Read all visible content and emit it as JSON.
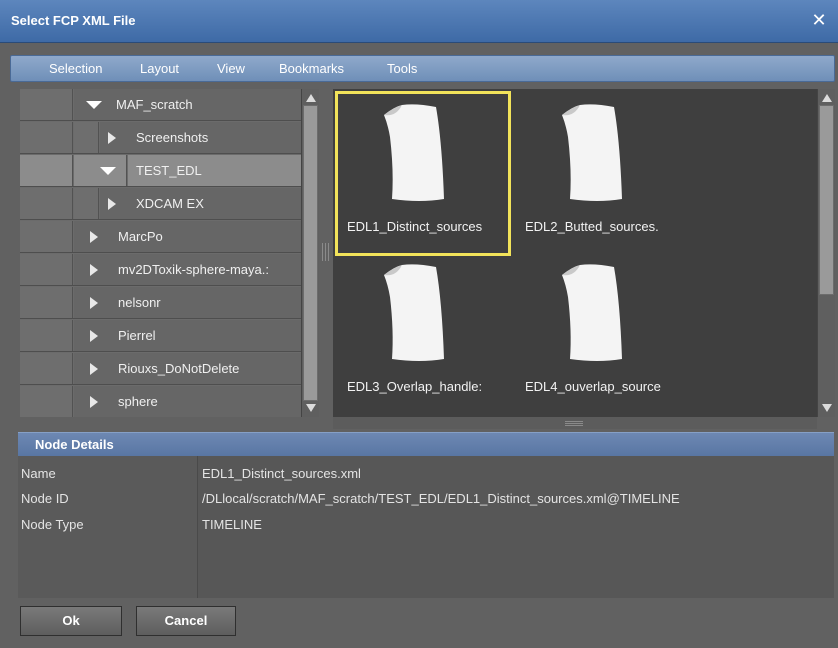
{
  "window": {
    "title": "Select FCP XML File",
    "close_glyph": "✕"
  },
  "menu": [
    "Selection",
    "Layout",
    "View",
    "Bookmarks",
    "Tools"
  ],
  "tree": [
    {
      "label": "MAF_scratch",
      "expanded": true,
      "selected": false
    },
    {
      "label": "Screenshots",
      "expanded": false,
      "selected": false
    },
    {
      "label": "TEST_EDL",
      "expanded": true,
      "selected": true
    },
    {
      "label": "XDCAM EX",
      "expanded": false,
      "selected": false
    },
    {
      "label": "MarcPo",
      "expanded": false,
      "selected": false
    },
    {
      "label": "mv2DToxik-sphere-maya.:",
      "expanded": false,
      "selected": false
    },
    {
      "label": "nelsonr",
      "expanded": false,
      "selected": false
    },
    {
      "label": "Pierrel",
      "expanded": false,
      "selected": false
    },
    {
      "label": "Riouxs_DoNotDelete",
      "expanded": false,
      "selected": false
    },
    {
      "label": "sphere",
      "expanded": false,
      "selected": false
    }
  ],
  "files": [
    {
      "name": "EDL1_Distinct_sources",
      "selected": true,
      "icon": "document-icon"
    },
    {
      "name": "EDL2_Butted_sources.",
      "selected": false,
      "icon": "document-icon"
    },
    {
      "name": "EDL3_Overlap_handle:",
      "selected": false,
      "icon": "document-icon"
    },
    {
      "name": "EDL4_ouverlap_source",
      "selected": false,
      "icon": "document-icon"
    }
  ],
  "details": {
    "title": "Node Details",
    "rows": [
      {
        "key": "Name",
        "value": "EDL1_Distinct_sources.xml"
      },
      {
        "key": "Node ID",
        "value": "/DLlocal/scratch/MAF_scratch/TEST_EDL/EDL1_Distinct_sources.xml@TIMELINE"
      },
      {
        "key": "Node Type",
        "value": "TIMELINE"
      }
    ]
  },
  "buttons": {
    "ok": "Ok",
    "cancel": "Cancel"
  },
  "colors": {
    "title_bar": "#4a74ad",
    "selection_outline": "#f2e35a",
    "file_pane_bg": "#3f3f3f"
  }
}
